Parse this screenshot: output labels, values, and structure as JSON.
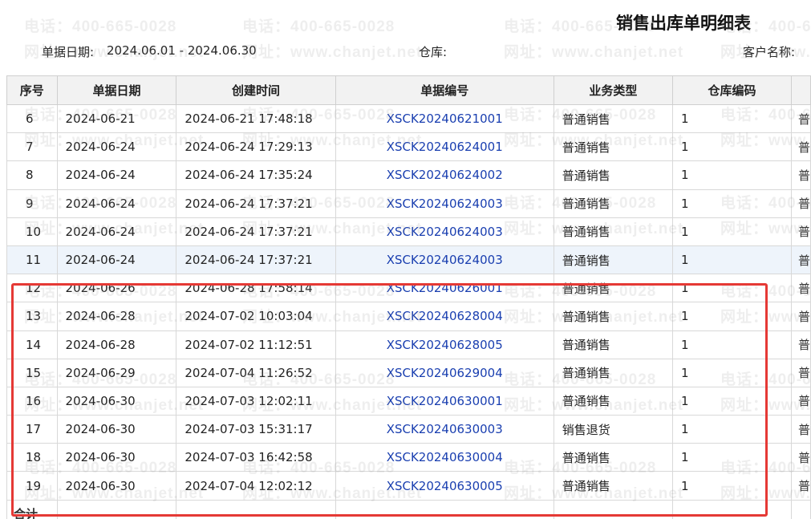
{
  "report": {
    "title": "销售出库单明细表",
    "date_label": "单据日期:",
    "date_range": "2024.06.01 - 2024.06.30",
    "warehouse_label": "仓库:",
    "customer_label": "客户名称:"
  },
  "watermark": {
    "phone": "电话：400-665-0028",
    "site": "网址：www.chanjet.net"
  },
  "table": {
    "headers": [
      "序号",
      "单据日期",
      "创建时间",
      "单据编号",
      "业务类型",
      "仓库编码"
    ],
    "rows": [
      {
        "seq": "6",
        "date": "2024-06-21",
        "created": "2024-06-21 17:48:18",
        "no": "XSCK20240621001",
        "type": "普通销售",
        "wh": "1",
        "extra": "普"
      },
      {
        "seq": "7",
        "date": "2024-06-24",
        "created": "2024-06-24 17:29:13",
        "no": "XSCK20240624001",
        "type": "普通销售",
        "wh": "1",
        "extra": "普"
      },
      {
        "seq": "8",
        "date": "2024-06-24",
        "created": "2024-06-24 17:35:24",
        "no": "XSCK20240624002",
        "type": "普通销售",
        "wh": "1",
        "extra": "普"
      },
      {
        "seq": "9",
        "date": "2024-06-24",
        "created": "2024-06-24 17:37:21",
        "no": "XSCK20240624003",
        "type": "普通销售",
        "wh": "1",
        "extra": "普"
      },
      {
        "seq": "10",
        "date": "2024-06-24",
        "created": "2024-06-24 17:37:21",
        "no": "XSCK20240624003",
        "type": "普通销售",
        "wh": "1",
        "extra": "普"
      },
      {
        "seq": "11",
        "date": "2024-06-24",
        "created": "2024-06-24 17:37:21",
        "no": "XSCK20240624003",
        "type": "普通销售",
        "wh": "1",
        "extra": "普"
      },
      {
        "seq": "12",
        "date": "2024-06-26",
        "created": "2024-06-28 17:58:14",
        "no": "XSCK20240626001",
        "type": "普通销售",
        "wh": "1",
        "extra": "普"
      },
      {
        "seq": "13",
        "date": "2024-06-28",
        "created": "2024-07-02 10:03:04",
        "no": "XSCK20240628004",
        "type": "普通销售",
        "wh": "1",
        "extra": "普"
      },
      {
        "seq": "14",
        "date": "2024-06-28",
        "created": "2024-07-02 11:12:51",
        "no": "XSCK20240628005",
        "type": "普通销售",
        "wh": "1",
        "extra": "普"
      },
      {
        "seq": "15",
        "date": "2024-06-29",
        "created": "2024-07-04 11:26:52",
        "no": "XSCK20240629004",
        "type": "普通销售",
        "wh": "1",
        "extra": "普"
      },
      {
        "seq": "16",
        "date": "2024-06-30",
        "created": "2024-07-03 12:02:11",
        "no": "XSCK20240630001",
        "type": "普通销售",
        "wh": "1",
        "extra": "普"
      },
      {
        "seq": "17",
        "date": "2024-06-30",
        "created": "2024-07-03 15:31:17",
        "no": "XSCK20240630003",
        "type": "销售退货",
        "wh": "1",
        "extra": "普"
      },
      {
        "seq": "18",
        "date": "2024-06-30",
        "created": "2024-07-03 16:42:58",
        "no": "XSCK20240630004",
        "type": "普通销售",
        "wh": "1",
        "extra": "普"
      },
      {
        "seq": "19",
        "date": "2024-06-30",
        "created": "2024-07-04 12:02:12",
        "no": "XSCK20240630005",
        "type": "普通销售",
        "wh": "1",
        "extra": "普"
      }
    ],
    "total_label": "合计",
    "selected_row_seq": "11"
  },
  "colors": {
    "link": "#1a3fb0",
    "header_bg": "#f2f2f2",
    "selected_row_bg": "#eef4fb",
    "highlight_border": "#e53935"
  }
}
